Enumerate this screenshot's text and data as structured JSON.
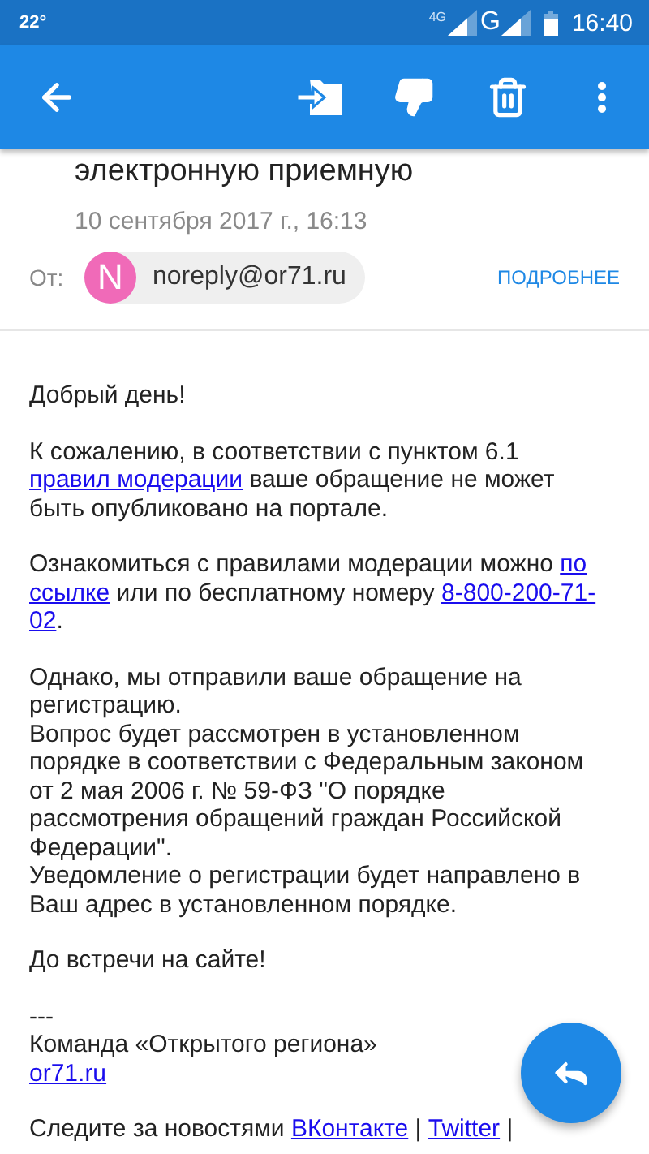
{
  "status_bar": {
    "temperature": "22°",
    "networks": [
      "4G",
      "G"
    ],
    "time": "16:40"
  },
  "header": {
    "subject": "электронную приемную",
    "date": "10 сентября 2017 г., 16:13",
    "from_label": "От:",
    "sender": {
      "initial": "N",
      "address": "noreply@or71.ru"
    },
    "details_link": "ПОДРОБНЕЕ"
  },
  "body": [
    {
      "lines": [
        [
          {
            "kind": "text",
            "text": "Добрый день!"
          }
        ]
      ]
    },
    {
      "lines": [
        [
          {
            "kind": "text",
            "text": "К сожалению, в соответствии с пунктом 6.1"
          }
        ],
        [
          {
            "kind": "link",
            "text": "правил модерации"
          },
          {
            "kind": "text",
            "text": " ваше обращение не может"
          }
        ],
        [
          {
            "kind": "text",
            "text": "быть опубликовано на портале."
          }
        ]
      ]
    },
    {
      "lines": [
        [
          {
            "kind": "text",
            "text": "Ознакомиться с правилами модерации можно "
          },
          {
            "kind": "link",
            "text": "по"
          }
        ],
        [
          {
            "kind": "link",
            "text": "ссылке"
          },
          {
            "kind": "text",
            "text": " или по бесплатному номеру "
          },
          {
            "kind": "link",
            "text": "8-800-200-71-"
          }
        ],
        [
          {
            "kind": "link",
            "text": "02"
          },
          {
            "kind": "text",
            "text": "."
          }
        ]
      ]
    },
    {
      "lines": [
        [
          {
            "kind": "text",
            "text": "Однако, мы отправили ваше обращение на"
          }
        ],
        [
          {
            "kind": "text",
            "text": "регистрацию."
          }
        ],
        [
          {
            "kind": "text",
            "text": "Вопрос будет рассмотрен в установленном"
          }
        ],
        [
          {
            "kind": "text",
            "text": "порядке в соответствии с Федеральным законом"
          }
        ],
        [
          {
            "kind": "text",
            "text": "от 2 мая 2006 г. № 59-ФЗ \"О порядке"
          }
        ],
        [
          {
            "kind": "text",
            "text": "рассмотрения обращений граждан Российской"
          }
        ],
        [
          {
            "kind": "text",
            "text": "Федерации\"."
          }
        ],
        [
          {
            "kind": "text",
            "text": "Уведомление о регистрации будет направлено в"
          }
        ],
        [
          {
            "kind": "text",
            "text": "Ваш адрес в установленном порядке."
          }
        ]
      ]
    },
    {
      "lines": [
        [
          {
            "kind": "text",
            "text": "До встречи на сайте!"
          }
        ]
      ]
    },
    {
      "lines": [
        [
          {
            "kind": "text",
            "text": "---"
          }
        ],
        [
          {
            "kind": "text",
            "text": "Команда «Открытого региона»"
          }
        ],
        [
          {
            "kind": "link",
            "text": "or71.ru"
          }
        ]
      ]
    },
    {
      "lines": [
        [
          {
            "kind": "text",
            "text": "Следите за новостями "
          },
          {
            "kind": "link",
            "text": "ВКонтакте"
          },
          {
            "kind": "text",
            "text": " | "
          },
          {
            "kind": "link",
            "text": "Twitter"
          },
          {
            "kind": "text",
            "text": " |"
          }
        ]
      ]
    }
  ]
}
